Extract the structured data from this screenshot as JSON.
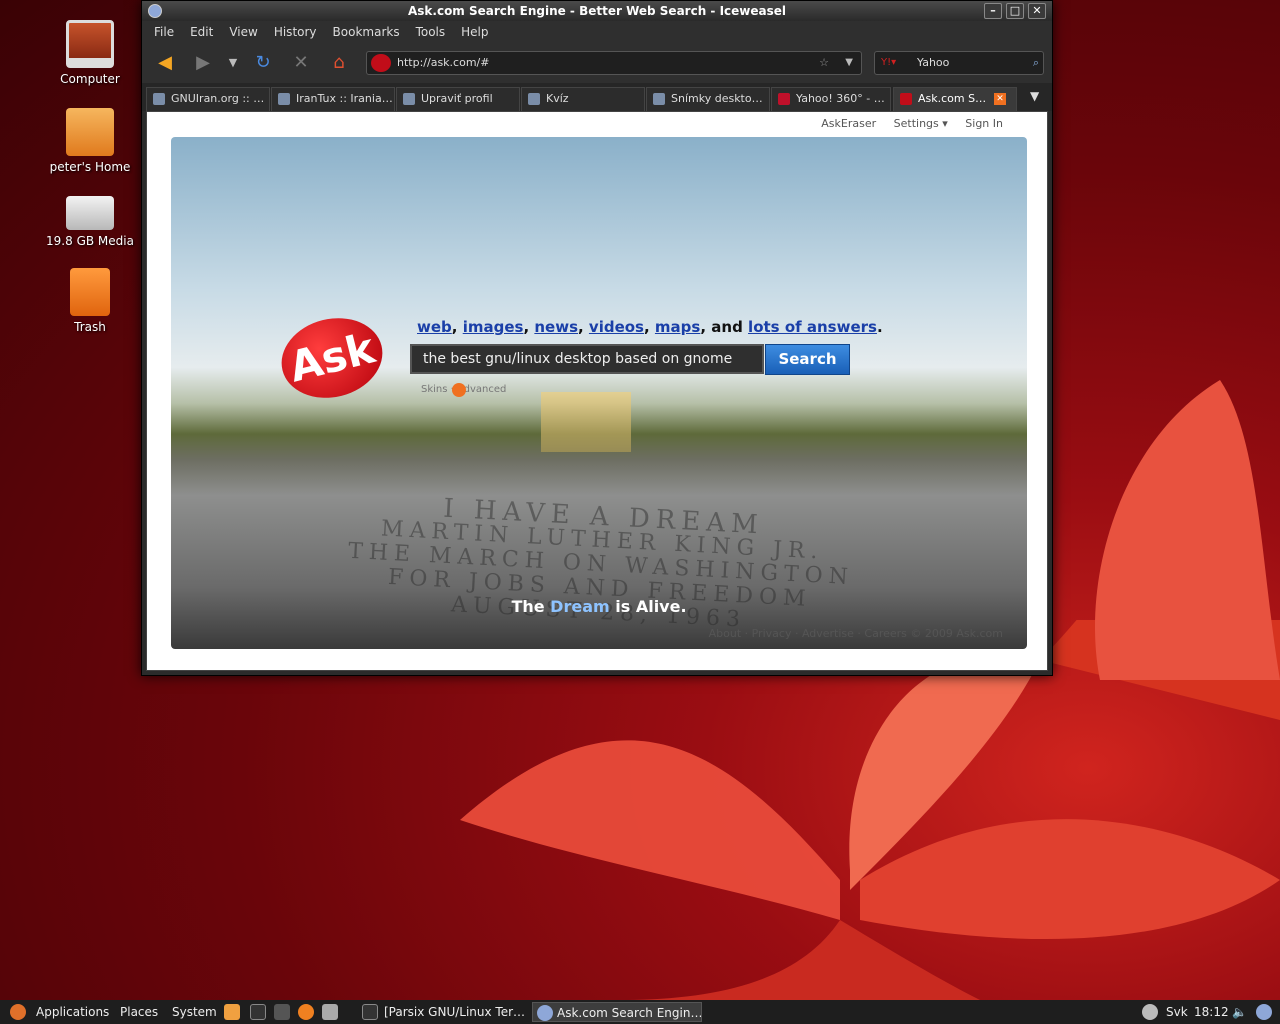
{
  "desktop": {
    "icons": [
      {
        "label": "Computer",
        "icon": "computer-icon"
      },
      {
        "label": "peter's Home",
        "icon": "home-folder-icon"
      },
      {
        "label": "19.8 GB Media",
        "icon": "drive-icon"
      },
      {
        "label": "Trash",
        "icon": "trash-icon"
      }
    ]
  },
  "window": {
    "title": "Ask.com Search Engine - Better Web Search - Iceweasel"
  },
  "menu": [
    "File",
    "Edit",
    "View",
    "History",
    "Bookmarks",
    "Tools",
    "Help"
  ],
  "nav": {
    "url": "http://ask.com/#",
    "search_engine": "Yahoo"
  },
  "tabs": [
    "GNUIran.org :: …",
    "IranTux :: Irania…",
    "Upraviť profil",
    "Kvíz",
    "Snímky deskto…",
    "Yahoo! 360° - …",
    "Ask.com S…"
  ],
  "page": {
    "top_links": [
      "AskEraser",
      "Settings ▾",
      "Sign In"
    ],
    "verticals": {
      "web": "web",
      "images": "images",
      "news": "news",
      "videos": "videos",
      "maps": "maps",
      "and": "and",
      "answers": "lots of answers"
    },
    "query": "the best gnu/linux desktop based on gnome",
    "search_label": "Search",
    "skins": "Skins · Advanced",
    "logo": "Ask",
    "engraving": [
      "I HAVE A DREAM",
      "MARTIN LUTHER KING JR.",
      "THE MARCH ON WASHINGTON",
      "FOR JOBS AND FREEDOM",
      "AUGUST 28, 1963"
    ],
    "tagline": {
      "pre": "The",
      "dream": "Dream",
      "post": "is Alive."
    },
    "footer": "About · Privacy · Advertise · Careers    © 2009 Ask.com"
  },
  "panel": {
    "menus": [
      "Applications",
      "Places",
      "System"
    ],
    "tasks": [
      "[Parsix GNU/Linux Ter…",
      "Ask.com Search Engin…"
    ],
    "keyboard": "Svk",
    "clock": "18:12"
  },
  "colors": {
    "accent": "#1a3fa8",
    "ask_red": "#c10d19",
    "search_blue": "#2f7fd6"
  }
}
